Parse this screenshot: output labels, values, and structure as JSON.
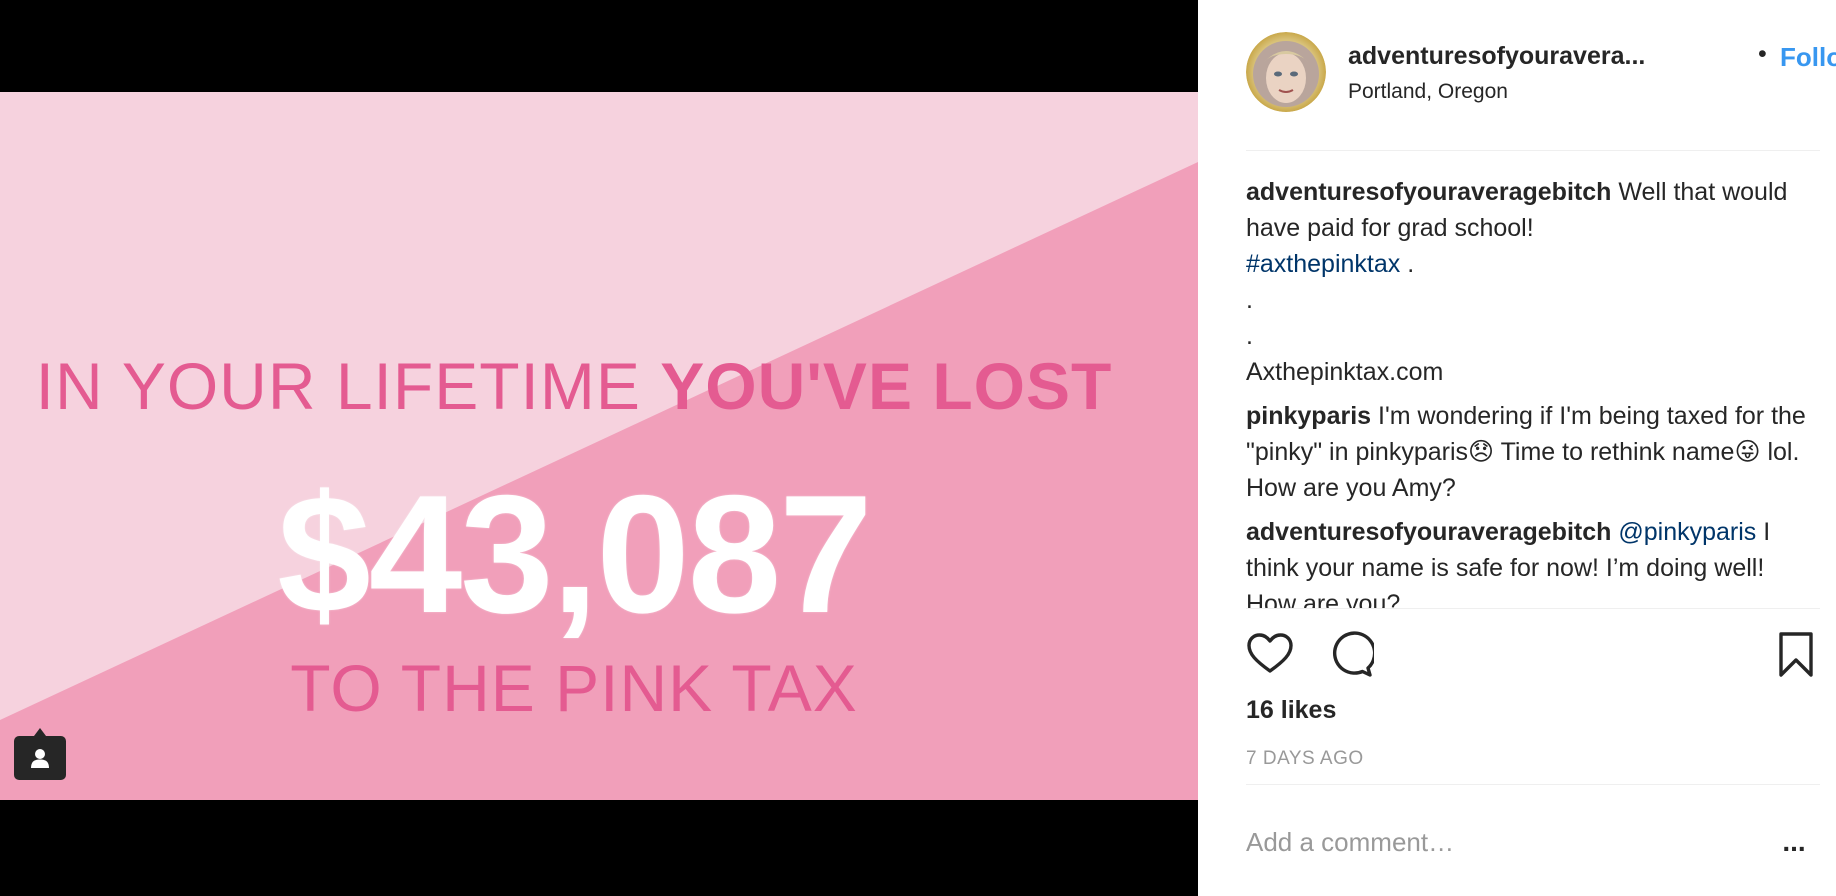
{
  "post": {
    "image": {
      "headline_regular": "IN YOUR LIFETIME ",
      "headline_bold": "YOU'VE LOST",
      "amount": "$43,087",
      "footline": "TO THE PINK TAX",
      "colors": {
        "light_pink": "#f6d2de",
        "dark_pink": "#f19fba",
        "text_pink": "#e45b91"
      }
    },
    "tag_icon": "person-tag-icon"
  },
  "header": {
    "username": "adventuresofyouravera...",
    "separator": "•",
    "follow_label": "Follow",
    "location": "Portland, Oregon"
  },
  "comments": [
    {
      "user": "adventuresofyouraveragebitch",
      "text": " Well that would have paid for grad school!",
      "hashtag": "#axthepinktax",
      "after_hashtag": " .",
      "extra_lines": [
        ".",
        ".",
        "Axthepinktax.com"
      ]
    },
    {
      "user": "pinkyparis",
      "text_1": " I'm wondering if I'm being taxed for the \"pinky\" in pinkyparis",
      "emoji_1": "😞",
      "text_2": " Time to rethink name",
      "emoji_2": "😜",
      "text_3": " lol. How are you Amy?"
    },
    {
      "user": "adventuresofyouraveragebitch",
      "mention": " @pinkyparis",
      "text": " I think your name is safe for now! I’m doing well! How are you?"
    }
  ],
  "actions": {
    "like_icon": "heart-icon",
    "comment_icon": "comment-bubble-icon",
    "save_icon": "bookmark-icon"
  },
  "likes": "16 likes",
  "timestamp": "7 DAYS AGO",
  "comment_box": {
    "placeholder": "Add a comment…",
    "more_label": "..."
  }
}
